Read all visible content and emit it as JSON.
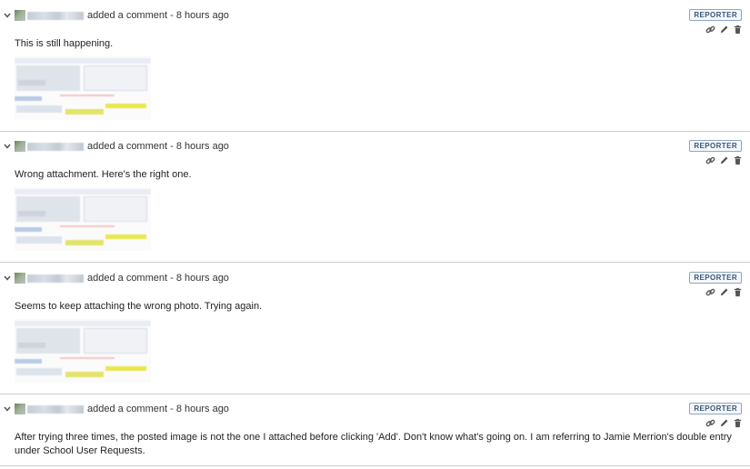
{
  "comments": [
    {
      "meta": "added a comment - 8 hours ago",
      "badge": "REPORTER",
      "text": "This is still happening.",
      "has_thumbnail": true
    },
    {
      "meta": "added a comment - 8 hours ago",
      "badge": "REPORTER",
      "text": "Wrong attachment. Here's the right one.",
      "has_thumbnail": true
    },
    {
      "meta": "added a comment - 8 hours ago",
      "badge": "REPORTER",
      "text": "Seems to keep attaching the wrong photo. Trying again.",
      "has_thumbnail": true
    },
    {
      "meta": "added a comment - 8 hours ago",
      "badge": "REPORTER",
      "text": "After trying three times, the posted image is not the one I attached before clicking 'Add'. Don't know what's going on. I am referring to Jamie Merrion's double entry under School User Requests.",
      "has_thumbnail": false
    }
  ],
  "icons": {
    "collapse": "chevron-down-icon",
    "permalink": "link-icon",
    "edit": "pencil-icon",
    "delete": "trash-icon"
  },
  "colors": {
    "badge_border": "#8ea6c0",
    "badge_text": "#3a5675",
    "divider": "#cccccc",
    "icon": "#555555",
    "highlight": "#e8e84a"
  }
}
